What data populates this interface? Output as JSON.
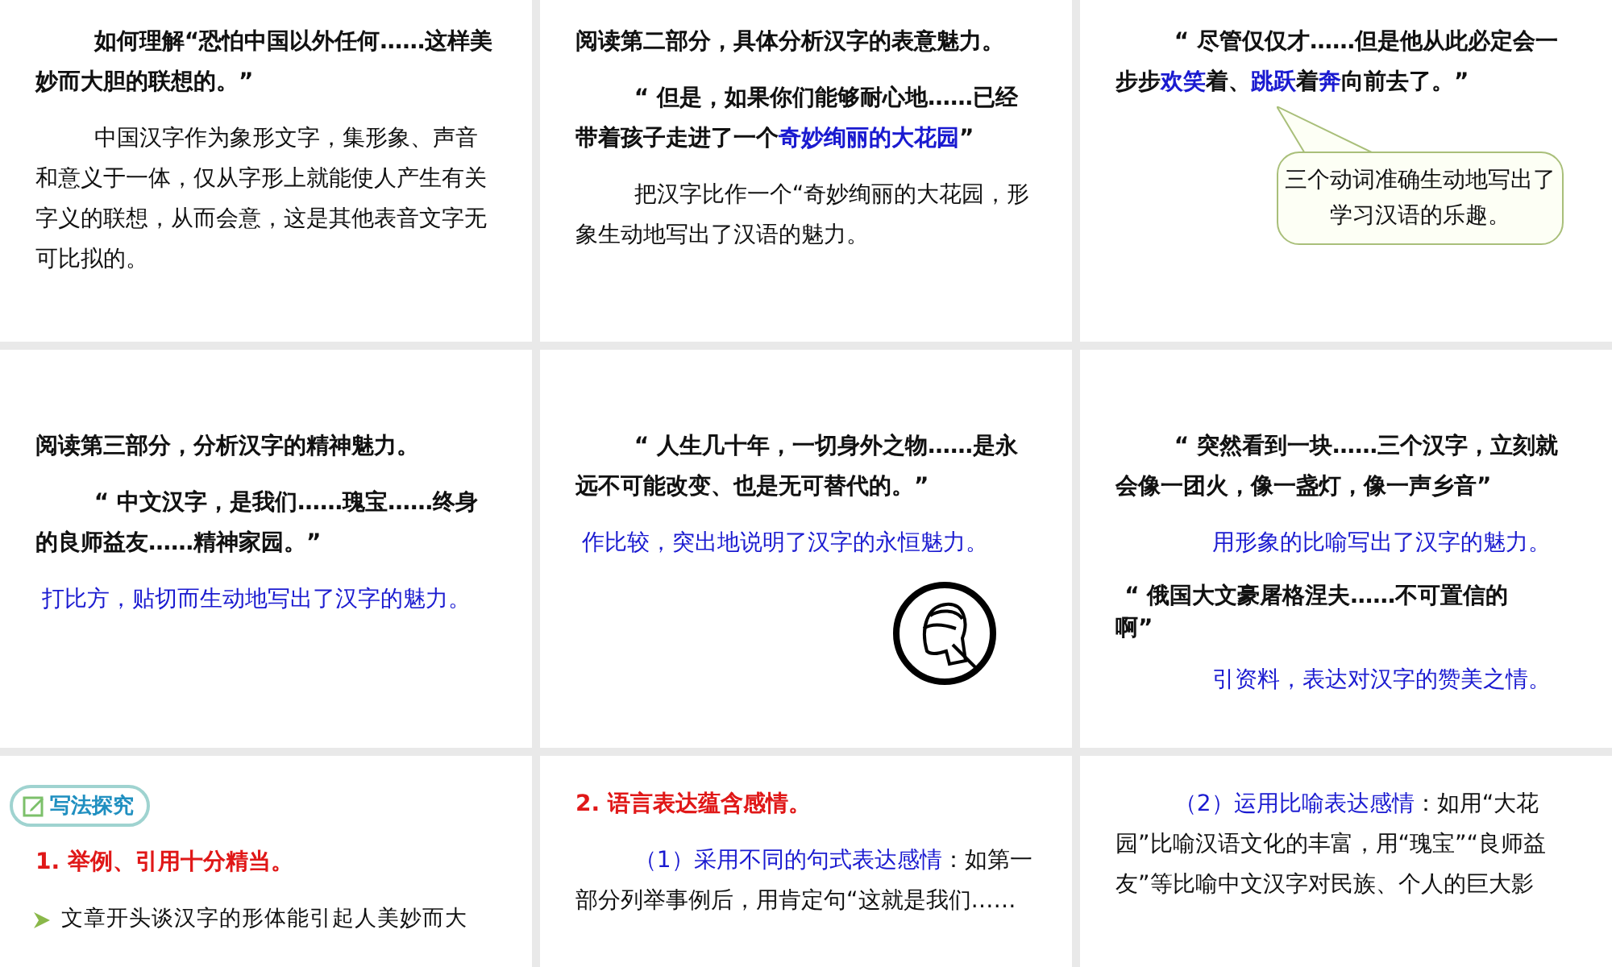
{
  "slides": [
    {
      "blocks": [
        {
          "kind": "quote",
          "segments": [
            {
              "text": "如何理解“恐怕中国以外任何……这样美妙而大胆的联想的。”",
              "emphasis": false
            }
          ]
        },
        {
          "kind": "body",
          "segments": [
            {
              "text": "中国汉字作为象形文字，集形象、声音和意义于一体，仅从字形上就能使人产生有关字义的联想，从而会意，这是其他表音文字无可比拟的。",
              "emphasis": false
            }
          ]
        }
      ]
    },
    {
      "blocks": [
        {
          "kind": "title",
          "segments": [
            {
              "text": "阅读第二部分，具体分析汉字的表意魅力。",
              "emphasis": false
            }
          ]
        },
        {
          "kind": "quote",
          "segments": [
            {
              "text": "“ 但是，如果你们能够耐心地……已经带着孩子走进了一个",
              "emphasis": false
            },
            {
              "text": "奇妙绚丽的大花园",
              "emphasis": true
            },
            {
              "text": "”",
              "emphasis": false
            }
          ]
        },
        {
          "kind": "body",
          "segments": [
            {
              "text": "把汉字比作一个“奇妙绚丽的大花园，形象生动地写出了汉语的魅力。",
              "emphasis": false
            }
          ]
        }
      ]
    },
    {
      "blocks": [
        {
          "kind": "quote",
          "segments": [
            {
              "text": "“ 尽管仅仅才……但是他从此必定会一步步",
              "emphasis": false
            },
            {
              "text": "欢笑",
              "emphasis": true
            },
            {
              "text": "着、",
              "emphasis": false
            },
            {
              "text": "跳跃",
              "emphasis": true
            },
            {
              "text": "着",
              "emphasis": false
            },
            {
              "text": "奔",
              "emphasis": true
            },
            {
              "text": "向前去了。”",
              "emphasis": false
            }
          ]
        },
        {
          "kind": "callout",
          "segments": [
            {
              "text": "三个动词准确生动地写出了学习汉语的乐趣。",
              "emphasis": false
            }
          ]
        }
      ]
    },
    {
      "blocks": [
        {
          "kind": "title",
          "segments": [
            {
              "text": "阅读第三部分，分析汉字的精神魅力。",
              "emphasis": false
            }
          ]
        },
        {
          "kind": "quote",
          "segments": [
            {
              "text": "“ 中文汉字，是我们……瑰宝……终身的良师益友……精神家园。”",
              "emphasis": false
            }
          ]
        },
        {
          "kind": "note",
          "segments": [
            {
              "text": "打比方，贴切而生动地写出了汉字的魅力。",
              "emphasis": true
            }
          ]
        }
      ]
    },
    {
      "blocks": [
        {
          "kind": "quote",
          "segments": [
            {
              "text": "“ 人生几十年，一切身外之物……是永远不可能改变、也是无可替代的。”",
              "emphasis": false
            }
          ]
        },
        {
          "kind": "note",
          "segments": [
            {
              "text": "作比较，突出地说明了汉字的永恒魅力。",
              "emphasis": true
            }
          ]
        },
        {
          "kind": "stamp"
        }
      ]
    },
    {
      "blocks": [
        {
          "kind": "quote",
          "segments": [
            {
              "text": "“ 突然看到一块……三个汉字，立刻就会像一团火，像一盏灯，像一声乡音”",
              "emphasis": false
            }
          ]
        },
        {
          "kind": "note-right",
          "segments": [
            {
              "text": "用形象的比喻写出了汉字的魅力。",
              "emphasis": true
            }
          ]
        },
        {
          "kind": "quote-plain",
          "segments": [
            {
              "text": "“ 俄国大文豪屠格涅夫……不可置信的啊”",
              "emphasis": false
            }
          ]
        },
        {
          "kind": "note-right",
          "segments": [
            {
              "text": "引资料，表达对汉字的赞美之情。",
              "emphasis": true
            }
          ]
        }
      ]
    },
    {
      "blocks": [
        {
          "kind": "badge",
          "segments": [
            {
              "text": "写法探究",
              "emphasis": false
            }
          ]
        },
        {
          "kind": "red-title",
          "segments": [
            {
              "text": "1. 举例、引用十分精当。",
              "emphasis": false
            }
          ]
        },
        {
          "kind": "bullet",
          "segments": [
            {
              "text": "文章开头谈汉字的形体能引起人美妙而大",
              "emphasis": false
            }
          ]
        }
      ]
    },
    {
      "blocks": [
        {
          "kind": "red-title",
          "segments": [
            {
              "text": "2. 语言表达蕴含感情。",
              "emphasis": false
            }
          ]
        },
        {
          "kind": "body",
          "segments": [
            {
              "text": "（1）采用不同的句式表达感情",
              "emphasis": true
            },
            {
              "text": "：如第一部分列举事例后，用肯定句“这就是我们……",
              "emphasis": false
            }
          ]
        }
      ]
    },
    {
      "blocks": [
        {
          "kind": "body",
          "segments": [
            {
              "text": "（2）运用比喻表达感情",
              "emphasis": true
            },
            {
              "text": "：如用“大花园”比喻汉语文化的丰富，用“瑰宝”“良师益友”等比喻中文汉字对民族、个人的巨大影",
              "emphasis": false
            }
          ]
        }
      ]
    }
  ]
}
